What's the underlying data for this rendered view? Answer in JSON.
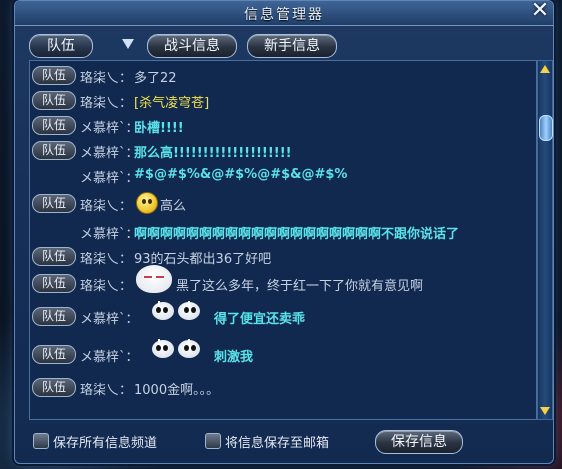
{
  "window": {
    "title": "信息管理器",
    "close_glyph": "✕"
  },
  "tabs": {
    "channel": "队伍",
    "battle": "战斗信息",
    "newbie": "新手信息"
  },
  "messages": [
    {
      "channel": "队伍",
      "sender": "珞柒乀：",
      "text": "多了22",
      "style": "plain"
    },
    {
      "channel": "队伍",
      "sender": "珞柒乀：",
      "text": "[杀气凌穹苍]",
      "style": "yellow"
    },
    {
      "channel": "队伍",
      "sender": "メ慕梓`：",
      "text": "卧槽!!!!",
      "style": "cyan-b"
    },
    {
      "channel": "队伍",
      "sender": "メ慕梓`：",
      "text": "那么高!!!!!!!!!!!!!!!!!!!!",
      "style": "cyan-b"
    },
    {
      "channel": "",
      "sender": "メ慕梓`：",
      "text": "#$@#$%&@#$%@#$&@#$%",
      "style": "cyan-b"
    },
    {
      "channel": "队伍",
      "sender": "珞柒乀：",
      "text": "高么",
      "style": "plain",
      "emoji": "face"
    },
    {
      "channel": "",
      "sender": "メ慕梓`：",
      "text": "啊啊啊啊啊啊啊啊啊啊啊啊啊啊啊啊啊啊啊不跟你说话了",
      "style": "cyan-b"
    },
    {
      "channel": "队伍",
      "sender": "珞柒乀：",
      "text": "93的石头都出36了好吧",
      "style": "plain"
    },
    {
      "channel": "队伍",
      "sender": "珞柒乀：",
      "text": "黑了这么多年，终于红一下了你就有意见啊",
      "style": "plain",
      "emoji": "blob"
    },
    {
      "channel": "队伍",
      "sender": "メ慕梓`：",
      "text": "得了便宜还卖乖",
      "style": "cyan-b",
      "emoji": "duo"
    },
    {
      "channel": "队伍",
      "sender": "メ慕梓`：",
      "text": "刺激我",
      "style": "cyan-b",
      "emoji": "duo"
    },
    {
      "channel": "队伍",
      "sender": "珞柒乀：",
      "text": "1000金啊。。。",
      "style": "plain"
    }
  ],
  "footer": {
    "save_all_label": "保存所有信息频道",
    "save_mail_label": "将信息保存至邮箱",
    "save_button": "保存信息"
  }
}
